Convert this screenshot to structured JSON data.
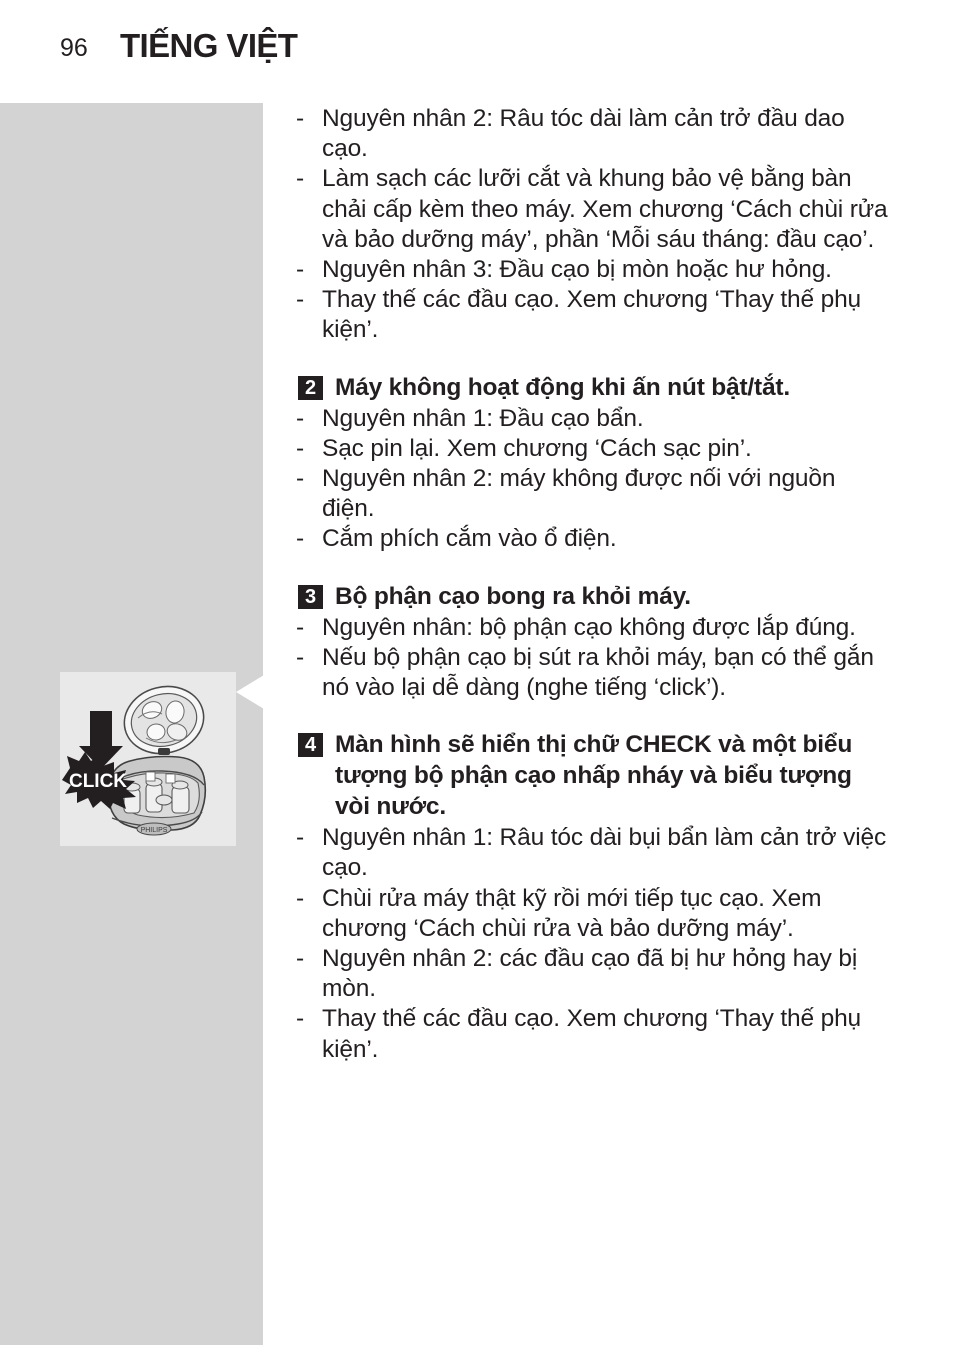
{
  "header": {
    "page_number": "96",
    "title": "TIẾNG VIỆT"
  },
  "illustration": {
    "name": "shaver-head-click-assembly",
    "badge_label": "CLICK",
    "arrow_icon": "down-arrow-icon",
    "panel_bg": "#e9e9e9",
    "sidebar_bg": "#d3d3d3"
  },
  "colors": {
    "text": "#231f20",
    "badge_bg": "#231f20",
    "badge_text": "#ffffff",
    "sidebar": "#d3d3d3",
    "panel": "#e9e9e9"
  },
  "content": {
    "intro_bullets": [
      "Nguyên nhân 2: Râu tóc dài làm cản trở đầu dao cạo.",
      "Làm sạch các lưỡi cắt và khung bảo vệ bằng bàn chải cấp kèm theo máy. Xem chương ‘Cách chùi rửa và bảo dưỡng máy’, phần ‘Mỗi sáu tháng: đầu cạo’.",
      "Nguyên nhân 3: Đầu cạo bị mòn hoặc hư hỏng.",
      "Thay thế các đầu cạo. Xem chương ‘Thay thế phụ kiện’."
    ],
    "sections": [
      {
        "number": "2",
        "heading": "Máy không hoạt động khi ấn nút bật/tắt.",
        "bullets": [
          "Nguyên nhân 1: Đầu cạo bẩn.",
          "Sạc pin lại. Xem chương ‘Cách sạc pin’.",
          "Nguyên nhân 2: máy không được nối với nguồn điện.",
          "Cắm phích cắm vào ổ điện."
        ]
      },
      {
        "number": "3",
        "heading": "Bộ phận cạo bong ra khỏi máy.",
        "bullets": [
          "Nguyên nhân: bộ phận cạo không được lắp đúng.",
          "Nếu bộ phận cạo bị sút ra khỏi máy, bạn có thể gắn nó vào lại dễ dàng (nghe tiếng ‘click’)."
        ]
      },
      {
        "number": "4",
        "heading": "Màn hình sẽ hiển thị chữ CHECK và một biểu tượng bộ phận cạo nhấp nháy và biểu tượng vòi nước.",
        "bullets": [
          "Nguyên nhân 1: Râu tóc dài bụi bẩn làm cản trở việc cạo.",
          "Chùi rửa máy thật kỹ rồi mới tiếp tục cạo. Xem chương ‘Cách chùi rửa và bảo dưỡng máy’.",
          "Nguyên nhân 2: các đầu cạo đã bị hư hỏng hay bị mòn.",
          "Thay thế các đầu cạo. Xem chương ‘Thay thế phụ kiện’."
        ]
      }
    ]
  }
}
